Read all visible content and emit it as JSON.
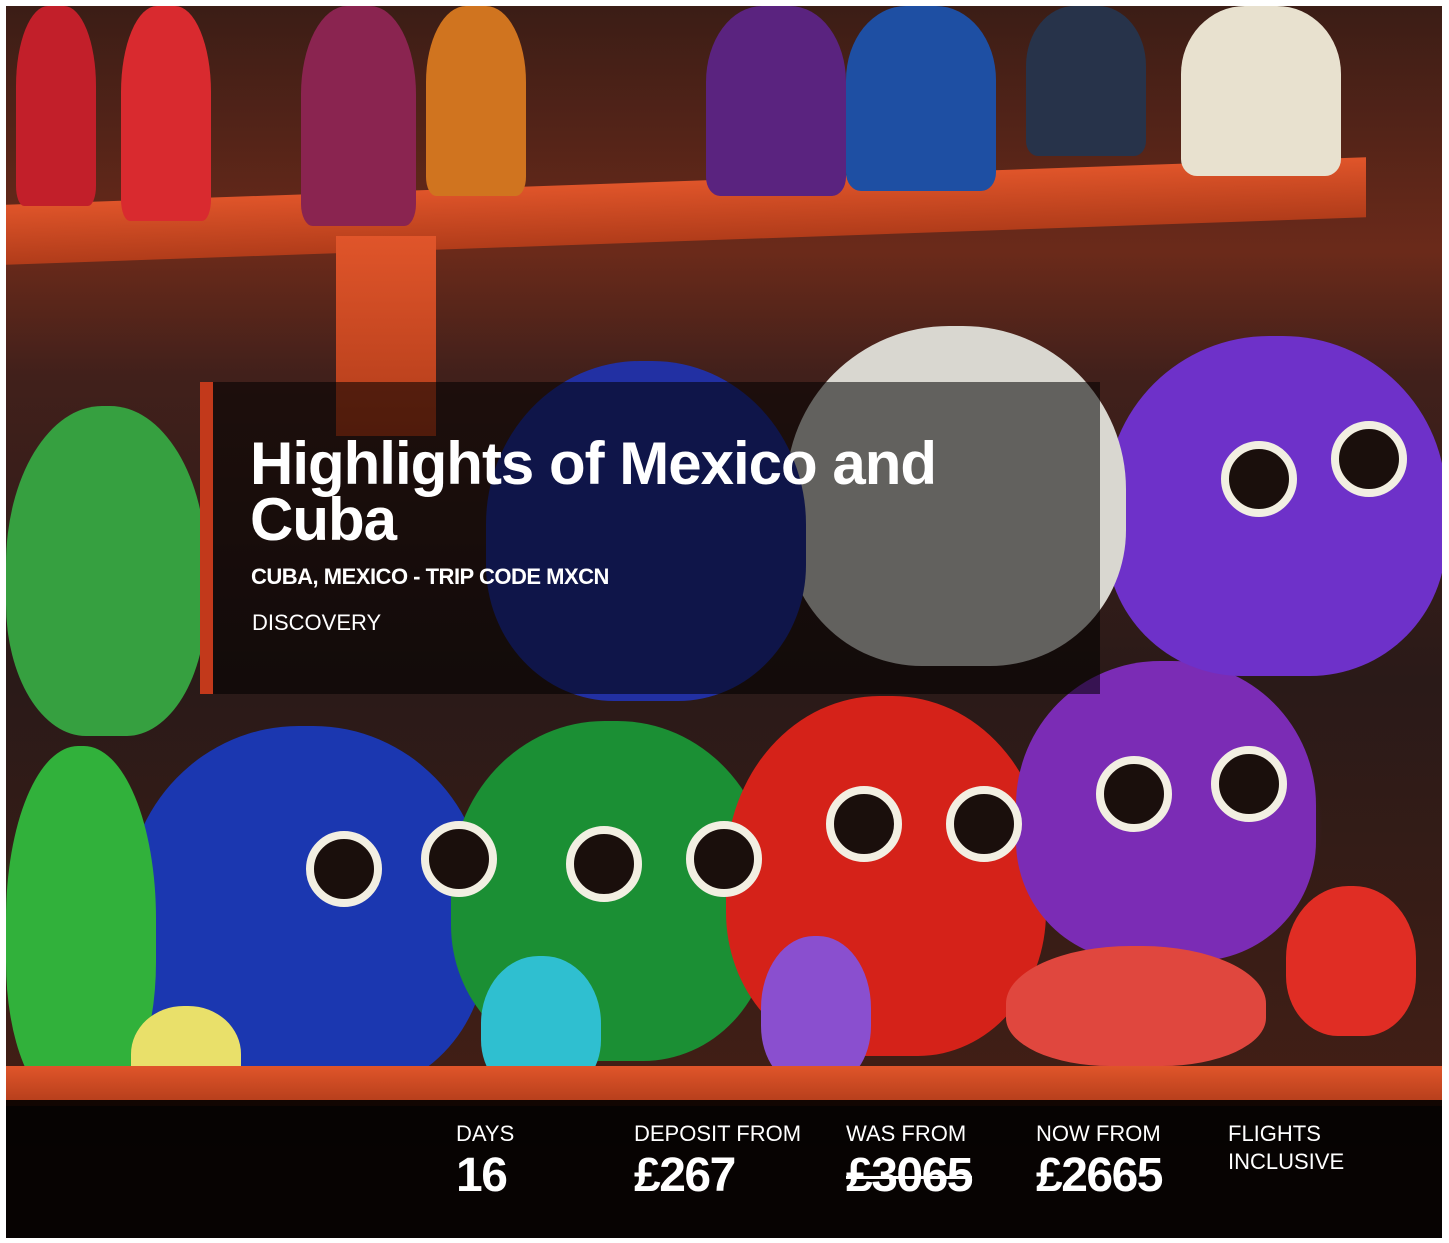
{
  "hero": {
    "image_alt": "Colorful painted sugar skulls and figurines on orange market shelves"
  },
  "trip": {
    "title": "Highlights of Mexico and Cuba",
    "subtitle": "CUBA, MEXICO - TRIP CODE MXCN",
    "style": "DISCOVERY"
  },
  "stats": {
    "days_label": "DAYS",
    "days_value": "16",
    "deposit_label": "DEPOSIT FROM",
    "deposit_value": "£267",
    "was_label": "WAS FROM",
    "was_value": "£3065",
    "now_label": "NOW FROM",
    "now_value": "£2665",
    "flights_label_line1": "FLIGHTS",
    "flights_label_line2": "INCLUSIVE"
  },
  "colors": {
    "accent": "#c2391b",
    "text": "#ffffff",
    "panel": "#000000"
  }
}
